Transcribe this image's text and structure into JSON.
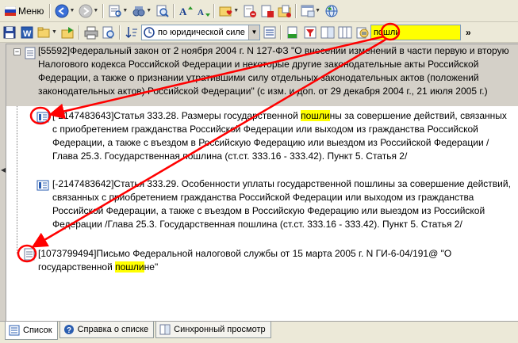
{
  "toolbar": {
    "menu_label": "Меню",
    "sort_value": "по юридической силе",
    "search_value": "пошли"
  },
  "documents": [
    {
      "id": "[55592]",
      "text": "Федеральный закон от 2 ноября 2004 г. N 127-ФЗ \"О внесении изменений в части первую и вторую Налогового кодекса Российской Федерации и некоторые другие законодательные акты Российской Федерации, а также о признании утратившими силу отдельных законодательных актов (положений законодательных актов) Российской Федерации\" (с изм. и доп. от 29 декабря 2004 г., 21 июля 2005 г.)"
    },
    {
      "id": "[-2147483643]",
      "text_before": "Статья 333.28. Размеры государственной ",
      "highlight": "пошли",
      "text_after": "ны за совершение действий, связанных с приобретением гражданства Российской Федерации или выходом из гражданства Российской Федерации, а также с въездом в Российскую Федерацию или выездом из Российской Федерации /Глава 25.3. Государственная пошлина (ст.ст. 333.16 - 333.42). Пункт 5. Статья 2/"
    },
    {
      "id": "[-2147483642]",
      "text": "Статья 333.29. Особенности уплаты государственной пошлины за совершение действий, связанных с приобретением гражданства Российской Федерации или выходом из гражданства Российской Федерации, а также с въездом в Российскую Федерацию или выездом из Российской Федерации /Глава 25.3. Государственная пошлина (ст.ст. 333.16 - 333.42). Пункт 5. Статья 2/"
    },
    {
      "id": "[1073799494]",
      "text_before": "Письмо Федеральной налоговой службы от 15 марта 2005 г. N ГИ-6-04/191@ \"О государственной ",
      "highlight": "пошли",
      "text_after": "не\""
    }
  ],
  "tabs": [
    {
      "label": "Список"
    },
    {
      "label": "Справка о списке"
    },
    {
      "label": "Синхронный просмотр"
    }
  ],
  "colors": {
    "highlight": "#ffff00",
    "annotation": "#ff0000"
  }
}
